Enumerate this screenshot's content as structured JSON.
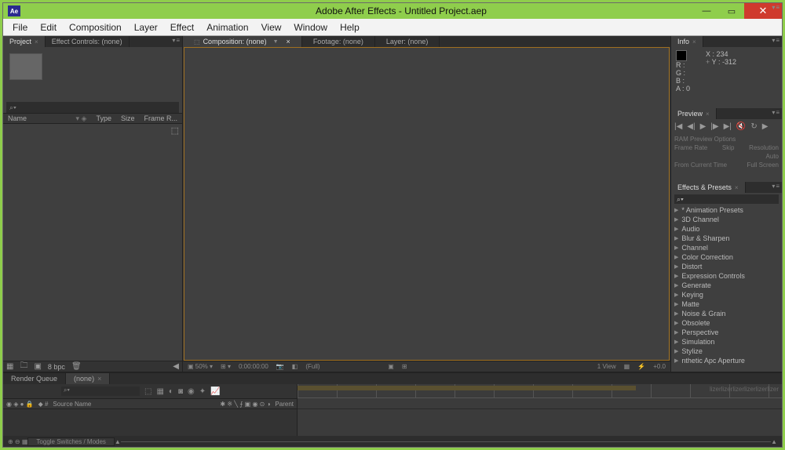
{
  "window": {
    "app_badge": "Ae",
    "title": "Adobe After Effects - Untitled Project.aep",
    "min": "—",
    "max": "▭",
    "close": "✕"
  },
  "menu": [
    "File",
    "Edit",
    "Composition",
    "Layer",
    "Effect",
    "Animation",
    "View",
    "Window",
    "Help"
  ],
  "project_panel": {
    "tab_project": "Project",
    "tab_effectcontrols": "Effect Controls: (none)",
    "search_icon": "⌕▾",
    "col_name": "Name",
    "col_type": "Type",
    "col_size": "Size",
    "col_fr": "Frame R...",
    "footer_bpc": "8 bpc"
  },
  "viewer": {
    "tab_comp": "Composition: (none)",
    "tab_footage": "Footage: (none)",
    "tab_layer": "Layer: (none)",
    "zoom": "50%",
    "timecode": "0:00:00:00",
    "full": "(Full)",
    "view": "1 View",
    "adj": "+0.0"
  },
  "info": {
    "title": "Info",
    "r": "R :",
    "g": "G :",
    "b": "B :",
    "a": "A : 0",
    "x": "X : 234",
    "y": "Y : -312"
  },
  "preview": {
    "title": "Preview",
    "ram": "RAM Preview Options",
    "fr": "Frame Rate",
    "skip": "Skip",
    "res": "Resolution",
    "auto": "Auto",
    "from": "From Current Time",
    "full": "Full Screen"
  },
  "effects": {
    "title": "Effects & Presets",
    "search_icon": "⌕▾",
    "cats": [
      "* Animation Presets",
      "3D Channel",
      "Audio",
      "Blur & Sharpen",
      "Channel",
      "Color Correction",
      "Distort",
      "Expression Controls",
      "Generate",
      "Keying",
      "Matte",
      "Noise & Grain",
      "Obsolete",
      "Perspective",
      "Simulation",
      "Stylize",
      "nthetic Apc Aperture"
    ]
  },
  "timeline": {
    "tab_rq": "Render Queue",
    "tab_none": "(none)",
    "col_source": "Source Name",
    "col_parent": "Parent",
    "switches": "Toggle Switches / Modes"
  }
}
